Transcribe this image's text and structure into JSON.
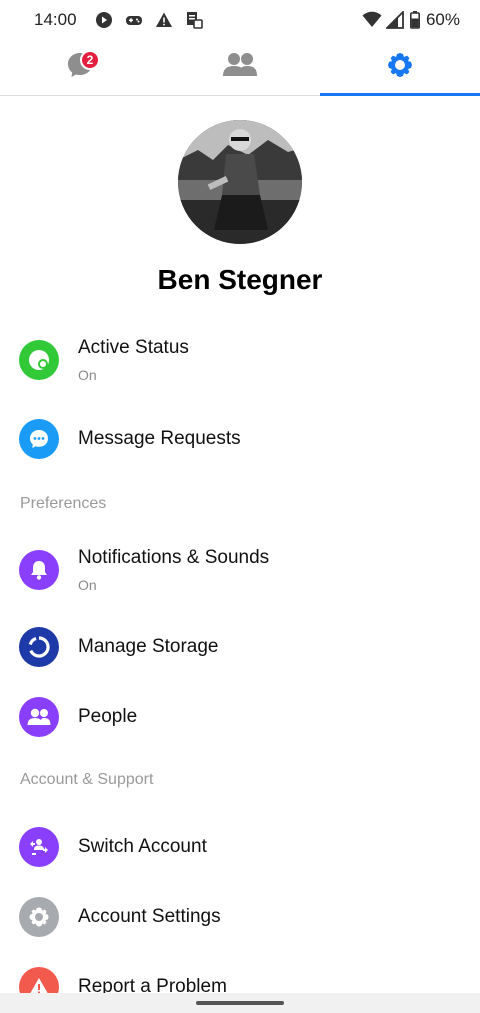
{
  "status_bar": {
    "time": "14:00",
    "battery": "60%",
    "icons": [
      "play-store-icon",
      "game-controller-icon",
      "warning-icon",
      "sim-icon",
      "wifi-icon",
      "signal-icon",
      "battery-icon"
    ]
  },
  "tabs": [
    {
      "name": "chats",
      "icon": "chat-bubble-icon",
      "badge": "2"
    },
    {
      "name": "people",
      "icon": "people-icon"
    },
    {
      "name": "settings",
      "icon": "gear-icon",
      "active": true
    }
  ],
  "colors": {
    "accent": "#1877f2",
    "active_status": "#31c937",
    "message_requests": "#1a9cf6",
    "notifications": "#8a3ffc",
    "manage_storage": "#1e3aa8",
    "people": "#8a3ffc",
    "switch_account": "#8a3ffc",
    "account_settings": "#a7aaae",
    "report_problem": "#f25a4d"
  },
  "profile": {
    "name": "Ben Stegner"
  },
  "items": {
    "active_status": {
      "label": "Active Status",
      "sub": "On",
      "icon": "active-status-icon"
    },
    "message_requests": {
      "label": "Message Requests",
      "icon": "chat-dots-icon"
    },
    "notifications": {
      "label": "Notifications & Sounds",
      "sub": "On",
      "icon": "bell-icon"
    },
    "manage_storage": {
      "label": "Manage Storage",
      "icon": "storage-icon"
    },
    "people": {
      "label": "People",
      "icon": "people-icon"
    },
    "switch_account": {
      "label": "Switch Account",
      "icon": "switch-account-icon"
    },
    "account_settings": {
      "label": "Account Settings",
      "icon": "gear-icon"
    },
    "report_problem": {
      "label": "Report a Problem",
      "icon": "warning-icon"
    }
  },
  "sections": {
    "preferences": "Preferences",
    "account_support": "Account & Support"
  }
}
